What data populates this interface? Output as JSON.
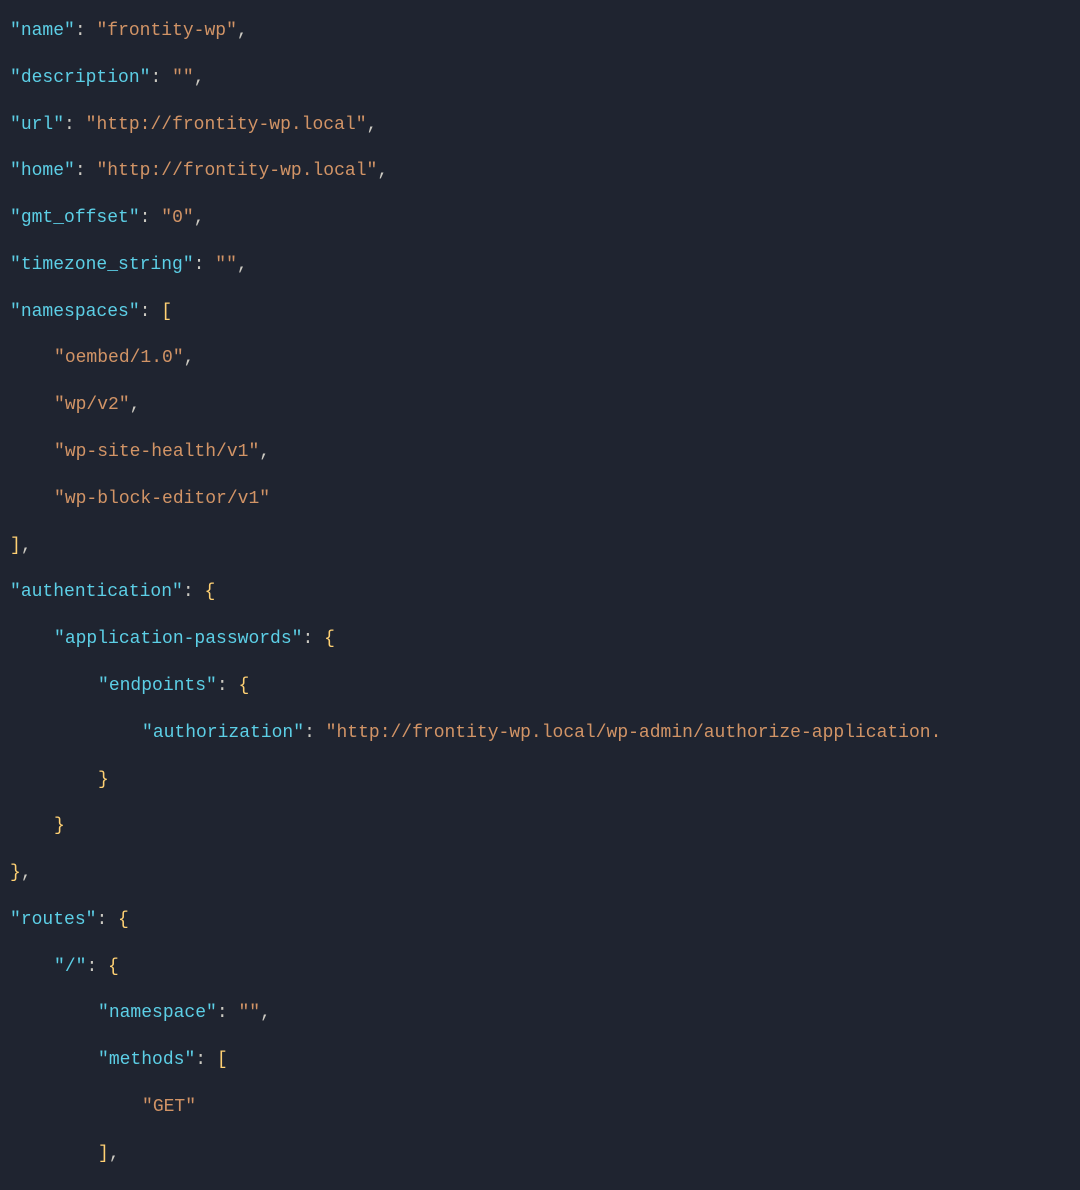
{
  "json": {
    "name": "frontity-wp",
    "description": "",
    "url": "http://frontity-wp.local",
    "home": "http://frontity-wp.local",
    "gmt_offset": "0",
    "timezone_string": "",
    "namespaces": [
      "oembed/1.0",
      "wp/v2",
      "wp-site-health/v1",
      "wp-block-editor/v1"
    ],
    "authentication": {
      "application_passwords": {
        "endpoints": {
          "authorization": "http://frontity-wp.local/wp-admin/authorize-application."
        }
      }
    },
    "routes": {
      "root": {
        "namespace": "",
        "methods": [
          "GET"
        ]
      }
    }
  },
  "labels": {
    "name": "name",
    "description": "description",
    "url": "url",
    "home": "home",
    "gmt_offset": "gmt_offset",
    "timezone_string": "timezone_string",
    "namespaces": "namespaces",
    "authentication": "authentication",
    "application_passwords": "application-passwords",
    "endpoints": "endpoints",
    "authorization": "authorization",
    "routes": "routes",
    "root_path": "/",
    "namespace": "namespace",
    "methods": "methods"
  }
}
